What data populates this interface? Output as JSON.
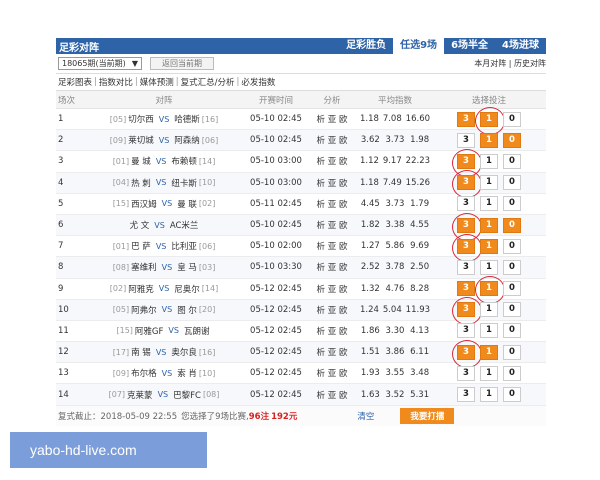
{
  "topbar": {
    "title": "足彩对阵",
    "modes": [
      "足彩胜负",
      "任选9场",
      "6场半全",
      "4场进球"
    ],
    "active_mode": 1
  },
  "toolbar": {
    "period_value": "18065期(当前期)",
    "period_arrow": "▼",
    "back_label": "返回当前期",
    "right_links": "本月对阵 | 历史对阵"
  },
  "subnav": [
    "足彩图表",
    "指数对比",
    "媒体预测",
    "复式汇总/分析",
    "必发指数"
  ],
  "columns": {
    "no": "场次",
    "match": "对阵",
    "time": "开赛时间",
    "analysis": "分析",
    "odds": "平均指数",
    "bet": "选择投注"
  },
  "rows": [
    {
      "no": "1",
      "hr": "[05]",
      "home": "切尔西",
      "away": "哈德斯",
      "ar": "[16]",
      "time": "05-10 02:45",
      "ana": "析 亚 欧",
      "o1": "1.18",
      "o2": "7.08",
      "o3": "16.60",
      "sel": [
        1,
        1,
        0
      ],
      "mark": [
        0,
        1,
        0
      ]
    },
    {
      "no": "2",
      "hr": "[09]",
      "home": "莱切城",
      "away": "阿森纳",
      "ar": "[06]",
      "time": "05-10 02:45",
      "ana": "析 亚 欧",
      "o1": "3.62",
      "o2": "3.73",
      "o3": "1.98",
      "sel": [
        0,
        1,
        1
      ],
      "mark": [
        0,
        0,
        0
      ]
    },
    {
      "no": "3",
      "hr": "[01]",
      "home": "曼 城",
      "away": "布赖顿",
      "ar": "[14]",
      "time": "05-10 03:00",
      "ana": "析 亚 欧",
      "o1": "1.12",
      "o2": "9.17",
      "o3": "22.23",
      "sel": [
        1,
        0,
        0
      ],
      "mark": [
        1,
        0,
        0
      ]
    },
    {
      "no": "4",
      "hr": "[04]",
      "home": "热 刺",
      "away": "纽卡斯",
      "ar": "[10]",
      "time": "05-10 03:00",
      "ana": "析 亚 欧",
      "o1": "1.18",
      "o2": "7.49",
      "o3": "15.26",
      "sel": [
        1,
        0,
        0
      ],
      "mark": [
        1,
        0,
        0
      ]
    },
    {
      "no": "5",
      "hr": "[15]",
      "home": "西汉姆",
      "away": "曼 联",
      "ar": "[02]",
      "time": "05-11 02:45",
      "ana": "析 亚 欧",
      "o1": "4.45",
      "o2": "3.73",
      "o3": "1.79",
      "sel": [
        0,
        0,
        0
      ],
      "mark": [
        0,
        0,
        0
      ]
    },
    {
      "no": "6",
      "hr": "",
      "home": "尤 文",
      "away": "AC米兰",
      "ar": "",
      "time": "05-10 02:45",
      "ana": "析 亚 欧",
      "o1": "1.82",
      "o2": "3.38",
      "o3": "4.55",
      "sel": [
        1,
        1,
        1
      ],
      "mark": [
        1,
        0,
        0
      ]
    },
    {
      "no": "7",
      "hr": "[01]",
      "home": "巴 萨",
      "away": "比利亚",
      "ar": "[06]",
      "time": "05-10 02:00",
      "ana": "析 亚 欧",
      "o1": "1.27",
      "o2": "5.86",
      "o3": "9.69",
      "sel": [
        1,
        1,
        0
      ],
      "mark": [
        1,
        0,
        0
      ]
    },
    {
      "no": "8",
      "hr": "[08]",
      "home": "塞维利",
      "away": "皇 马",
      "ar": "[03]",
      "time": "05-10 03:30",
      "ana": "析 亚 欧",
      "o1": "2.52",
      "o2": "3.78",
      "o3": "2.50",
      "sel": [
        0,
        0,
        0
      ],
      "mark": [
        0,
        0,
        0
      ]
    },
    {
      "no": "9",
      "hr": "[02]",
      "home": "阿雅克",
      "away": "尼奥尔",
      "ar": "[14]",
      "time": "05-12 02:45",
      "ana": "析 亚 欧",
      "o1": "1.32",
      "o2": "4.76",
      "o3": "8.28",
      "sel": [
        1,
        1,
        0
      ],
      "mark": [
        0,
        1,
        0
      ]
    },
    {
      "no": "10",
      "hr": "[05]",
      "home": "阿弗尔",
      "away": "图 尔",
      "ar": "[20]",
      "time": "05-12 02:45",
      "ana": "析 亚 欧",
      "o1": "1.24",
      "o2": "5.04",
      "o3": "11.93",
      "sel": [
        1,
        0,
        0
      ],
      "mark": [
        1,
        0,
        0
      ]
    },
    {
      "no": "11",
      "hr": "[15]",
      "home": "阿雅GF",
      "away": "瓦朗谢",
      "ar": "",
      "time": "05-12 02:45",
      "ana": "析 亚 欧",
      "o1": "1.86",
      "o2": "3.30",
      "o3": "4.13",
      "sel": [
        0,
        0,
        0
      ],
      "mark": [
        0,
        0,
        0
      ]
    },
    {
      "no": "12",
      "hr": "[17]",
      "home": "南 锡",
      "away": "奥尔良",
      "ar": "[16]",
      "time": "05-12 02:45",
      "ana": "析 亚 欧",
      "o1": "1.51",
      "o2": "3.86",
      "o3": "6.11",
      "sel": [
        1,
        1,
        0
      ],
      "mark": [
        1,
        0,
        0
      ]
    },
    {
      "no": "13",
      "hr": "[09]",
      "home": "布尔格",
      "away": "索 肖",
      "ar": "[10]",
      "time": "05-12 02:45",
      "ana": "析 亚 欧",
      "o1": "1.93",
      "o2": "3.55",
      "o3": "3.48",
      "sel": [
        0,
        0,
        0
      ],
      "mark": [
        0,
        0,
        0
      ]
    },
    {
      "no": "14",
      "hr": "[07]",
      "home": "克莱蒙",
      "away": "巴黎FC",
      "ar": "[08]",
      "time": "05-12 02:45",
      "ana": "析 亚 欧",
      "o1": "1.63",
      "o2": "3.52",
      "o3": "5.31",
      "sel": [
        0,
        0,
        0
      ],
      "mark": [
        0,
        0,
        0
      ]
    }
  ],
  "bet_labels": [
    "3",
    "1",
    "0"
  ],
  "vs": "VS",
  "footer": {
    "deadline": "复式截止：2018-05-09 22:55",
    "picked": "您选择了9场比赛,",
    "notes": "96注",
    "amount": "192元",
    "clear": "清空",
    "action": "我要打擂"
  },
  "watermark": "yabo-hd-live.com",
  "colors": {
    "brand": "#2e63a8",
    "accent": "#f08a1c",
    "mark": "#d9283a"
  }
}
